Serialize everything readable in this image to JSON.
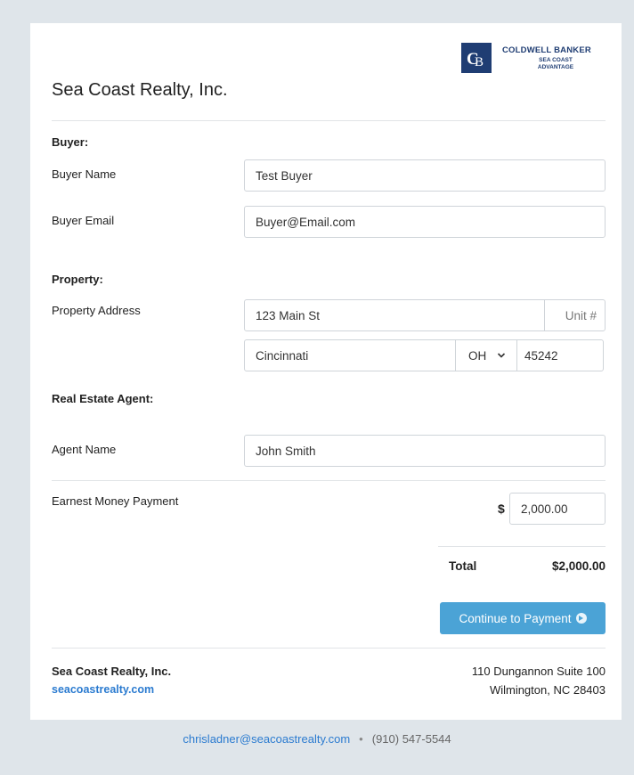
{
  "header": {
    "logo_line1": "COLDWELL BANKER",
    "logo_line2": "SEA COAST\nADVANTAGE",
    "company_title": "Sea Coast Realty, Inc."
  },
  "buyer": {
    "section_label": "Buyer:",
    "name_label": "Buyer Name",
    "name_value": "Test Buyer",
    "email_label": "Buyer Email",
    "email_value": "Buyer@Email.com"
  },
  "property": {
    "section_label": "Property:",
    "address_label": "Property Address",
    "street_value": "123 Main St",
    "unit_placeholder": "Unit #",
    "city_value": "Cincinnati",
    "state_value": "OH",
    "zip_value": "45242"
  },
  "agent": {
    "section_label": "Real Estate Agent:",
    "name_label": "Agent Name",
    "name_value": "John Smith"
  },
  "payment": {
    "earnest_label": "Earnest Money Payment",
    "currency_symbol": "$",
    "amount_value": "2,000.00",
    "total_label": "Total",
    "total_value": "$2,000.00",
    "continue_label": "Continue to Payment"
  },
  "footer": {
    "company_name": "Sea Coast Realty, Inc.",
    "website": "seacoastrealty.com",
    "address_line1": "110 Dungannon Suite 100",
    "address_line2": "Wilmington, NC 28403"
  },
  "contact": {
    "email": "chrisladner@seacoastrealty.com",
    "separator": "•",
    "phone": "(910) 547-5544"
  },
  "colors": {
    "accent": "#4ba3d6",
    "link": "#2b7bd0",
    "brand": "#1f3d73"
  }
}
